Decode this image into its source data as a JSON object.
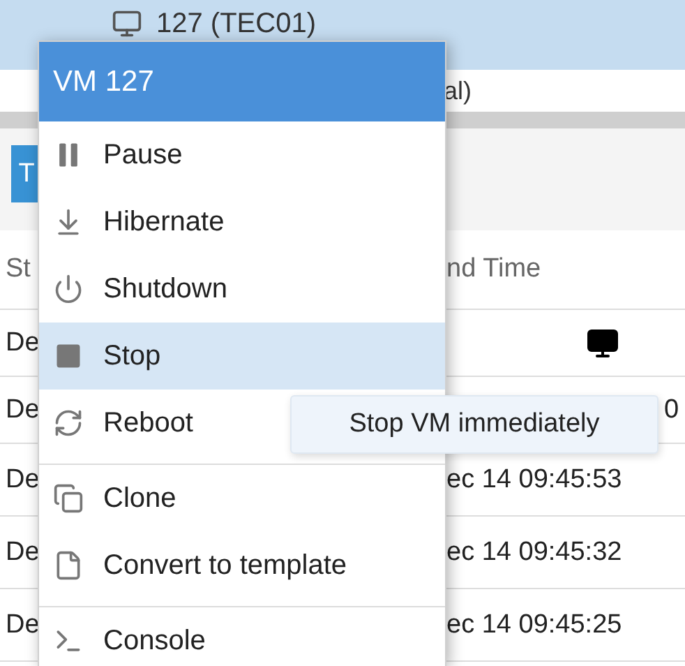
{
  "node_bar": {
    "title": "127 (TEC01)"
  },
  "subtitle": {
    "text": "al)"
  },
  "tab": {
    "label": "T",
    "selected": true
  },
  "table": {
    "columns": [
      {
        "label": "St"
      },
      {
        "label": "nd Time"
      }
    ],
    "rows": [
      {
        "cells": [
          "De",
          ""
        ],
        "console": true
      },
      {
        "cells": [
          "De",
          "0"
        ],
        "console": false
      },
      {
        "cells": [
          "De",
          "ec 14 09:45:53"
        ],
        "console": false
      },
      {
        "cells": [
          "De",
          "ec 14 09:45:32"
        ],
        "console": false
      },
      {
        "cells": [
          "De",
          "ec 14 09:45:25"
        ],
        "console": false
      }
    ]
  },
  "menu": {
    "title": "VM 127",
    "items": [
      {
        "label": "Pause",
        "hovered": false,
        "separator_before": false
      },
      {
        "label": "Hibernate",
        "hovered": false,
        "separator_before": false
      },
      {
        "label": "Shutdown",
        "hovered": false,
        "separator_before": false
      },
      {
        "label": "Stop",
        "hovered": true,
        "separator_before": false
      },
      {
        "label": "Reboot",
        "hovered": false,
        "separator_before": false
      },
      {
        "label": "Clone",
        "hovered": false,
        "separator_before": true
      },
      {
        "label": "Convert to template",
        "hovered": false,
        "separator_before": false
      },
      {
        "label": "Console",
        "hovered": false,
        "separator_before": true
      }
    ]
  },
  "tooltip": {
    "text": "Stop VM immediately"
  }
}
